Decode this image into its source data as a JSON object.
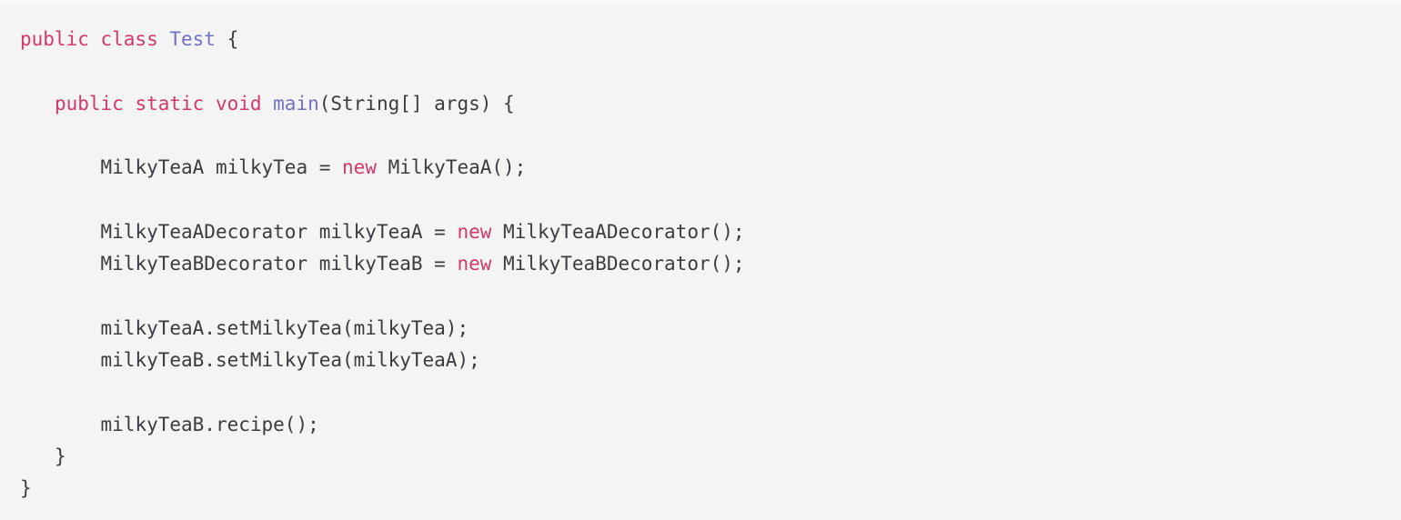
{
  "editor": {
    "language": "java",
    "background_color": "#f4f4f5",
    "plain_color": "#3c3c40",
    "keyword_color": "#d1396a",
    "type_color": "#7272c4",
    "lines": [
      {
        "indent": "",
        "tokens": [
          {
            "text": "public class ",
            "kind": "keyword"
          },
          {
            "text": "Test",
            "kind": "type"
          },
          {
            "text": " {",
            "kind": "plain"
          }
        ]
      },
      {
        "indent": "",
        "tokens": []
      },
      {
        "indent": "   ",
        "tokens": [
          {
            "text": "public static void ",
            "kind": "keyword"
          },
          {
            "text": "main",
            "kind": "type"
          },
          {
            "text": "(String[] args) {",
            "kind": "plain"
          }
        ]
      },
      {
        "indent": "",
        "tokens": []
      },
      {
        "indent": "       ",
        "tokens": [
          {
            "text": "MilkyTeaA milkyTea = ",
            "kind": "plain"
          },
          {
            "text": "new",
            "kind": "keyword"
          },
          {
            "text": " MilkyTeaA();",
            "kind": "plain"
          }
        ]
      },
      {
        "indent": "",
        "tokens": []
      },
      {
        "indent": "       ",
        "tokens": [
          {
            "text": "MilkyTeaADecorator milkyTeaA = ",
            "kind": "plain"
          },
          {
            "text": "new",
            "kind": "keyword"
          },
          {
            "text": " MilkyTeaADecorator();",
            "kind": "plain"
          }
        ]
      },
      {
        "indent": "       ",
        "tokens": [
          {
            "text": "MilkyTeaBDecorator milkyTeaB = ",
            "kind": "plain"
          },
          {
            "text": "new",
            "kind": "keyword"
          },
          {
            "text": " MilkyTeaBDecorator();",
            "kind": "plain"
          }
        ]
      },
      {
        "indent": "",
        "tokens": []
      },
      {
        "indent": "       ",
        "tokens": [
          {
            "text": "milkyTeaA.setMilkyTea(milkyTea);",
            "kind": "plain"
          }
        ]
      },
      {
        "indent": "       ",
        "tokens": [
          {
            "text": "milkyTeaB.setMilkyTea(milkyTeaA);",
            "kind": "plain"
          }
        ]
      },
      {
        "indent": "",
        "tokens": []
      },
      {
        "indent": "       ",
        "tokens": [
          {
            "text": "milkyTeaB.recipe();",
            "kind": "plain"
          }
        ]
      },
      {
        "indent": "   ",
        "tokens": [
          {
            "text": "}",
            "kind": "plain"
          }
        ]
      },
      {
        "indent": "",
        "tokens": [
          {
            "text": "}",
            "kind": "plain"
          }
        ]
      }
    ]
  }
}
